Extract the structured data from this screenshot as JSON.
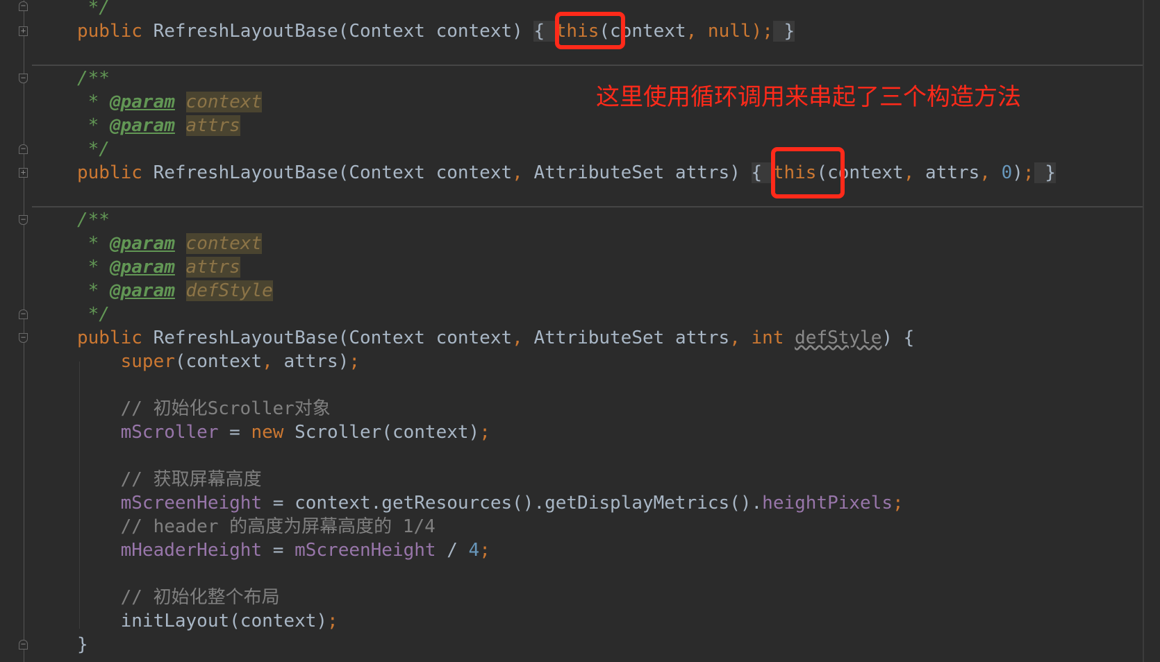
{
  "annotation": "这里使用循环调用来串起了三个构造方法",
  "colors": {
    "keyword": "#cc7832",
    "identifier": "#a9b7c6",
    "doc_comment": "#629755",
    "comment": "#808080",
    "field": "#9876aa",
    "number": "#6897bb",
    "highlight_box": "#ff2a1a",
    "background": "#2b2b2b"
  },
  "lines": [
    [
      {
        "c": "doc",
        "t": " */"
      }
    ],
    [
      {
        "c": "kw",
        "t": "public "
      },
      {
        "c": "id",
        "t": "RefreshLayoutBase(Context context) "
      },
      {
        "c": "fb",
        "t": "{ "
      },
      {
        "c": "kw",
        "t": "this"
      },
      {
        "c": "id",
        "t": "(context"
      },
      {
        "c": "kw",
        "t": ", null);"
      },
      {
        "c": "fb",
        "t": " }"
      }
    ],
    [],
    [
      {
        "c": "doc",
        "t": "/**"
      }
    ],
    [
      {
        "c": "doc",
        "t": " * "
      },
      {
        "c": "tag",
        "t": "@param"
      },
      {
        "c": "doc",
        "t": " "
      },
      {
        "c": "pv",
        "t": "context"
      }
    ],
    [
      {
        "c": "doc",
        "t": " * "
      },
      {
        "c": "tag",
        "t": "@param"
      },
      {
        "c": "doc",
        "t": " "
      },
      {
        "c": "pv",
        "t": "attrs"
      }
    ],
    [
      {
        "c": "doc",
        "t": " */"
      }
    ],
    [
      {
        "c": "kw",
        "t": "public "
      },
      {
        "c": "id",
        "t": "RefreshLayoutBase(Context context"
      },
      {
        "c": "kw",
        "t": ", "
      },
      {
        "c": "id",
        "t": "AttributeSet attrs) "
      },
      {
        "c": "fb",
        "t": "{ "
      },
      {
        "c": "kw",
        "t": "this"
      },
      {
        "c": "id",
        "t": "(context"
      },
      {
        "c": "kw",
        "t": ", "
      },
      {
        "c": "id",
        "t": "attrs"
      },
      {
        "c": "kw",
        "t": ", "
      },
      {
        "c": "num",
        "t": "0"
      },
      {
        "c": "id",
        "t": ")"
      },
      {
        "c": "kw",
        "t": ";"
      },
      {
        "c": "fb",
        "t": " }"
      }
    ],
    [],
    [
      {
        "c": "doc",
        "t": "/**"
      }
    ],
    [
      {
        "c": "doc",
        "t": " * "
      },
      {
        "c": "tag",
        "t": "@param"
      },
      {
        "c": "doc",
        "t": " "
      },
      {
        "c": "pv",
        "t": "context"
      }
    ],
    [
      {
        "c": "doc",
        "t": " * "
      },
      {
        "c": "tag",
        "t": "@param"
      },
      {
        "c": "doc",
        "t": " "
      },
      {
        "c": "pv",
        "t": "attrs"
      }
    ],
    [
      {
        "c": "doc",
        "t": " * "
      },
      {
        "c": "tag",
        "t": "@param"
      },
      {
        "c": "doc",
        "t": " "
      },
      {
        "c": "pv",
        "t": "defStyle"
      }
    ],
    [
      {
        "c": "doc",
        "t": " */"
      }
    ],
    [
      {
        "c": "kw",
        "t": "public "
      },
      {
        "c": "id",
        "t": "RefreshLayoutBase(Context context"
      },
      {
        "c": "kw",
        "t": ", "
      },
      {
        "c": "id",
        "t": "AttributeSet attrs"
      },
      {
        "c": "kw",
        "t": ", int "
      },
      {
        "c": "unused",
        "t": "defStyle"
      },
      {
        "c": "id",
        "t": ") {"
      }
    ],
    [
      {
        "c": "kw",
        "t": "    super"
      },
      {
        "c": "id",
        "t": "(context"
      },
      {
        "c": "kw",
        "t": ", "
      },
      {
        "c": "id",
        "t": "attrs)"
      },
      {
        "c": "kw",
        "t": ";"
      }
    ],
    [],
    [
      {
        "c": "cm",
        "t": "    // 初始化Scroller对象"
      }
    ],
    [
      {
        "c": "fd",
        "t": "    mScroller"
      },
      {
        "c": "id",
        "t": " = "
      },
      {
        "c": "kw",
        "t": "new "
      },
      {
        "c": "id",
        "t": "Scroller(context)"
      },
      {
        "c": "kw",
        "t": ";"
      }
    ],
    [],
    [
      {
        "c": "cm",
        "t": "    // 获取屏幕高度"
      }
    ],
    [
      {
        "c": "fd",
        "t": "    mScreenHeight"
      },
      {
        "c": "id",
        "t": " = context.getResources().getDisplayMetrics()."
      },
      {
        "c": "fd",
        "t": "heightPixels"
      },
      {
        "c": "kw",
        "t": ";"
      }
    ],
    [
      {
        "c": "cm",
        "t": "    // header 的高度为屏幕高度的 1/4"
      }
    ],
    [
      {
        "c": "fd",
        "t": "    mHeaderHeight"
      },
      {
        "c": "id",
        "t": " = "
      },
      {
        "c": "fd",
        "t": "mScreenHeight"
      },
      {
        "c": "id",
        "t": " / "
      },
      {
        "c": "num",
        "t": "4"
      },
      {
        "c": "kw",
        "t": ";"
      }
    ],
    [],
    [
      {
        "c": "cm",
        "t": "    // 初始化整个布局"
      }
    ],
    [
      {
        "c": "id",
        "t": "    initLayout(context)"
      },
      {
        "c": "kw",
        "t": ";"
      }
    ],
    [
      {
        "c": "id",
        "t": "}"
      }
    ]
  ]
}
